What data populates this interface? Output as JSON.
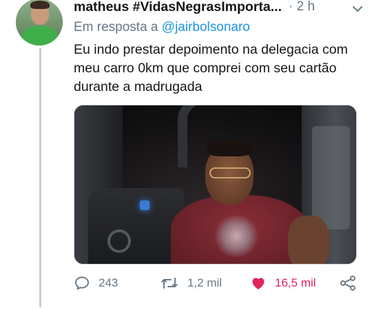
{
  "tweet": {
    "display_name": "matheus #VidasNegrasImporta...",
    "time": "· 2 h",
    "reply_prefix": "Em resposta a",
    "reply_mention": "@jairbolsonaro",
    "text": "Eu indo prestar depoimento na delegacia com meu carro 0km que comprei com seu cartão durante a madrugada"
  },
  "actions": {
    "replies": "243",
    "retweets": "1,2 mil",
    "likes": "16,5 mil"
  },
  "icons": {
    "reply": "reply-icon",
    "retweet": "retweet-icon",
    "like": "heart-icon",
    "share": "share-icon",
    "menu": "chevron-down-icon"
  },
  "colors": {
    "text": "#14171a",
    "secondary": "#657786",
    "link": "#1b95e0",
    "like": "#e0245e",
    "thread_line": "#c4cfd6"
  }
}
